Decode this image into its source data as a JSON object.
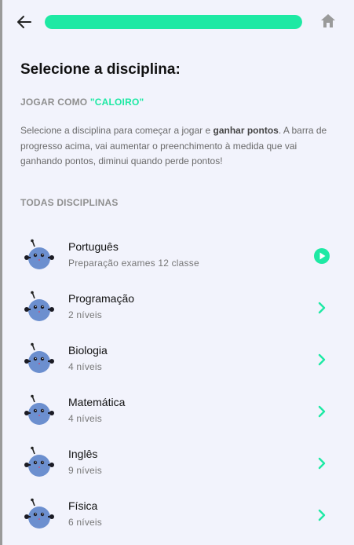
{
  "header": {
    "progress_fraction": 1.0,
    "accent_color": "#1ee9a4",
    "back_icon": "arrow-left-icon",
    "home_icon": "home-icon"
  },
  "page": {
    "title": "Selecione a disciplina:",
    "play_as_prefix": "JOGAR COMO ",
    "play_as_level": "\"CALOIRO\"",
    "description_part1": "Selecione a disciplina para começar a jogar e ",
    "description_bold": "ganhar pontos",
    "description_part2": ". A barra de progresso acima, vai aumentar o preenchimento à medida que vai ganhando pontos, diminui quando perde pontos!",
    "section_label": "TODAS DISCIPLINAS"
  },
  "subjects": [
    {
      "name": "Português",
      "subtitle": "Preparação exames 12 classe",
      "action_icon": "play-circle-icon"
    },
    {
      "name": "Programação",
      "subtitle": "2 níveis",
      "action_icon": "chevron-right-icon"
    },
    {
      "name": "Biologia",
      "subtitle": "4 níveis",
      "action_icon": "chevron-right-icon"
    },
    {
      "name": "Matemática",
      "subtitle": "4 níveis",
      "action_icon": "chevron-right-icon"
    },
    {
      "name": "Inglês",
      "subtitle": "9 níveis",
      "action_icon": "chevron-right-icon"
    },
    {
      "name": "Física",
      "subtitle": "6 níveis",
      "action_icon": "chevron-right-icon"
    }
  ]
}
